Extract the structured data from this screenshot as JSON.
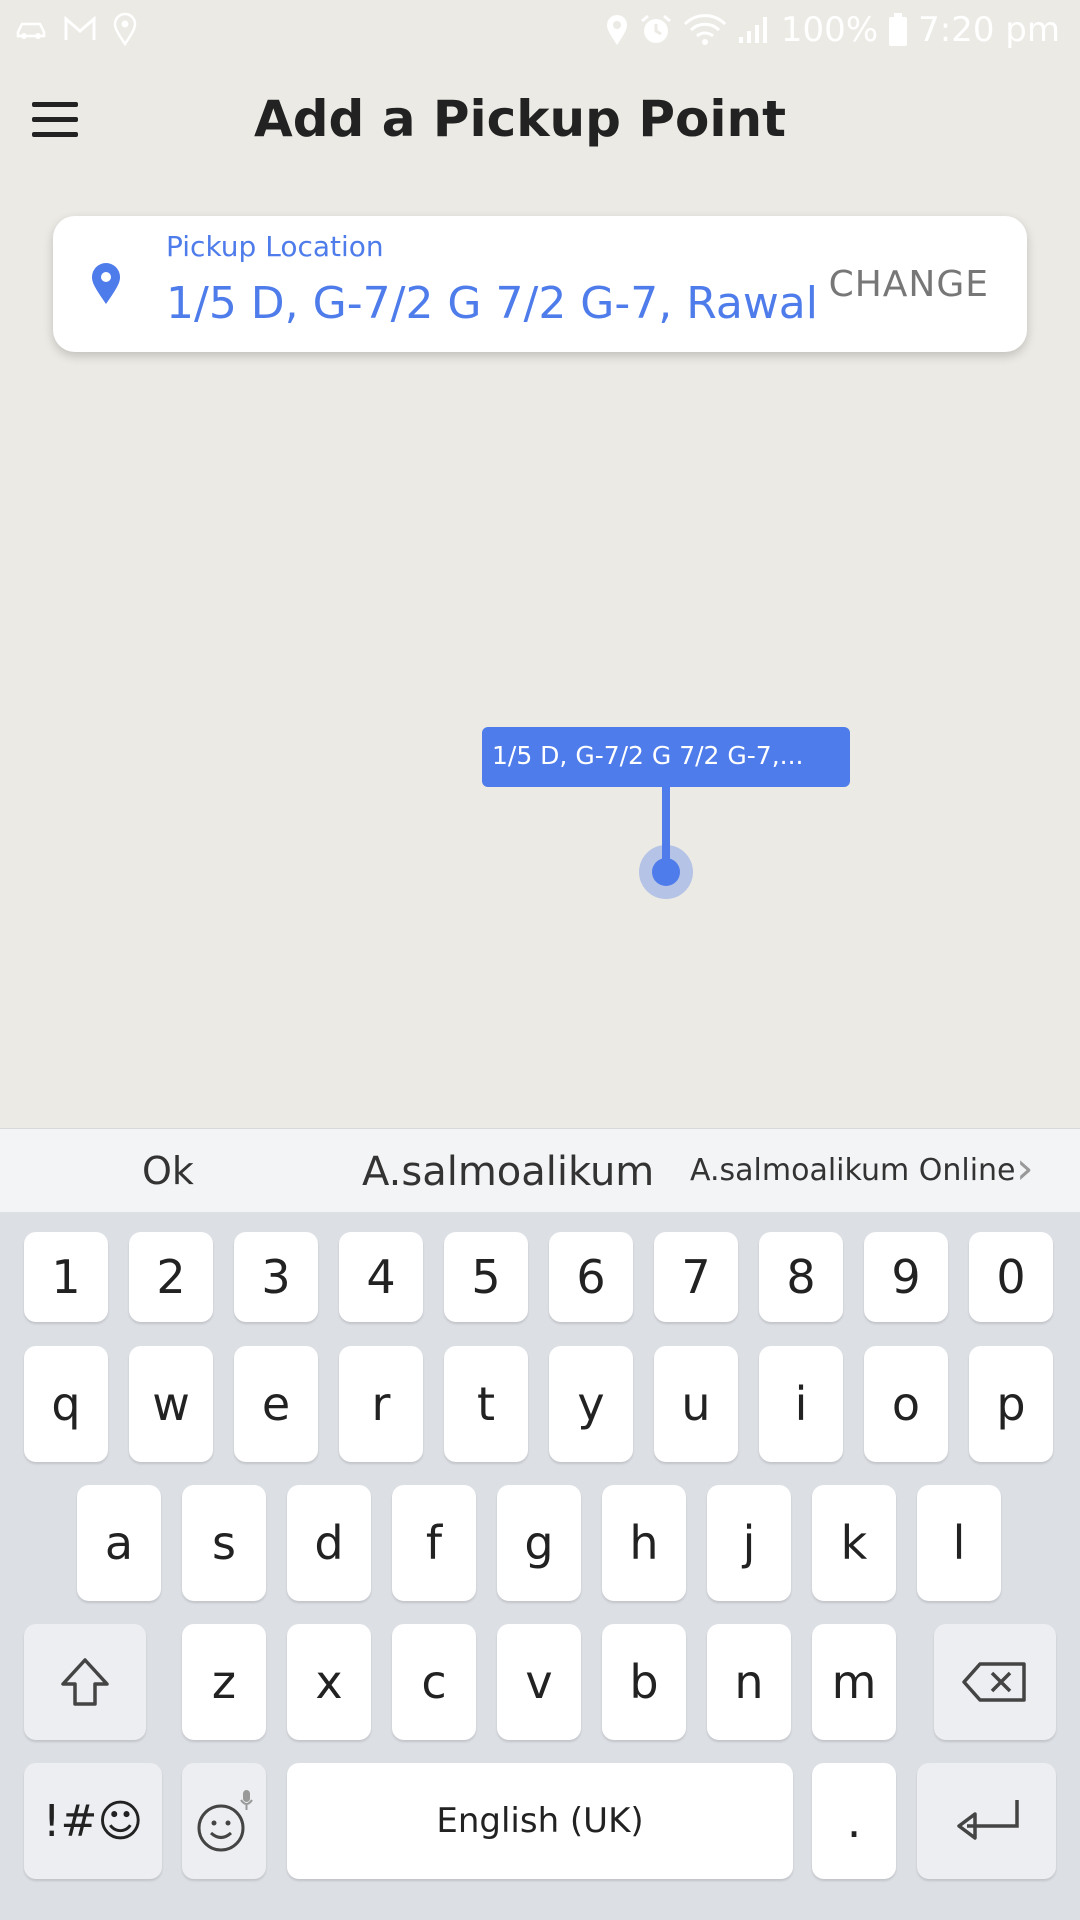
{
  "status_bar": {
    "left_icons": [
      "car-icon",
      "gmail-icon",
      "location-outline-icon"
    ],
    "right_icons": [
      "location-icon",
      "alarm-icon",
      "wifi-icon",
      "signal-icon",
      "battery-icon"
    ],
    "battery": "100%",
    "time": "7:20 pm"
  },
  "app_bar": {
    "title": "Add a Pickup Point",
    "menu_icon": "hamburger-menu-icon"
  },
  "pickup": {
    "label": "Pickup Location",
    "address": "1/5 D, G-7/2 G 7/2 G-7, Rawal",
    "change_label": "CHANGE",
    "icon": "location-pin-icon"
  },
  "map": {
    "marker_label": "1/5 D, G-7/2 G 7/2 G-7,...",
    "accent": "#4F7CEB"
  },
  "keyboard": {
    "suggestions": [
      "Ok",
      "A.salmoalikum",
      "A.salmoalikum Online"
    ],
    "row_numbers": [
      "1",
      "2",
      "3",
      "4",
      "5",
      "6",
      "7",
      "8",
      "9",
      "0"
    ],
    "row_1": [
      "q",
      "w",
      "e",
      "r",
      "t",
      "y",
      "u",
      "i",
      "o",
      "p"
    ],
    "row_2": [
      "a",
      "s",
      "d",
      "f",
      "g",
      "h",
      "j",
      "k",
      "l"
    ],
    "row_3": [
      "z",
      "x",
      "c",
      "v",
      "b",
      "n",
      "m"
    ],
    "symbols_label": "!#☺",
    "space_label": "English (UK)",
    "period_label": "."
  }
}
